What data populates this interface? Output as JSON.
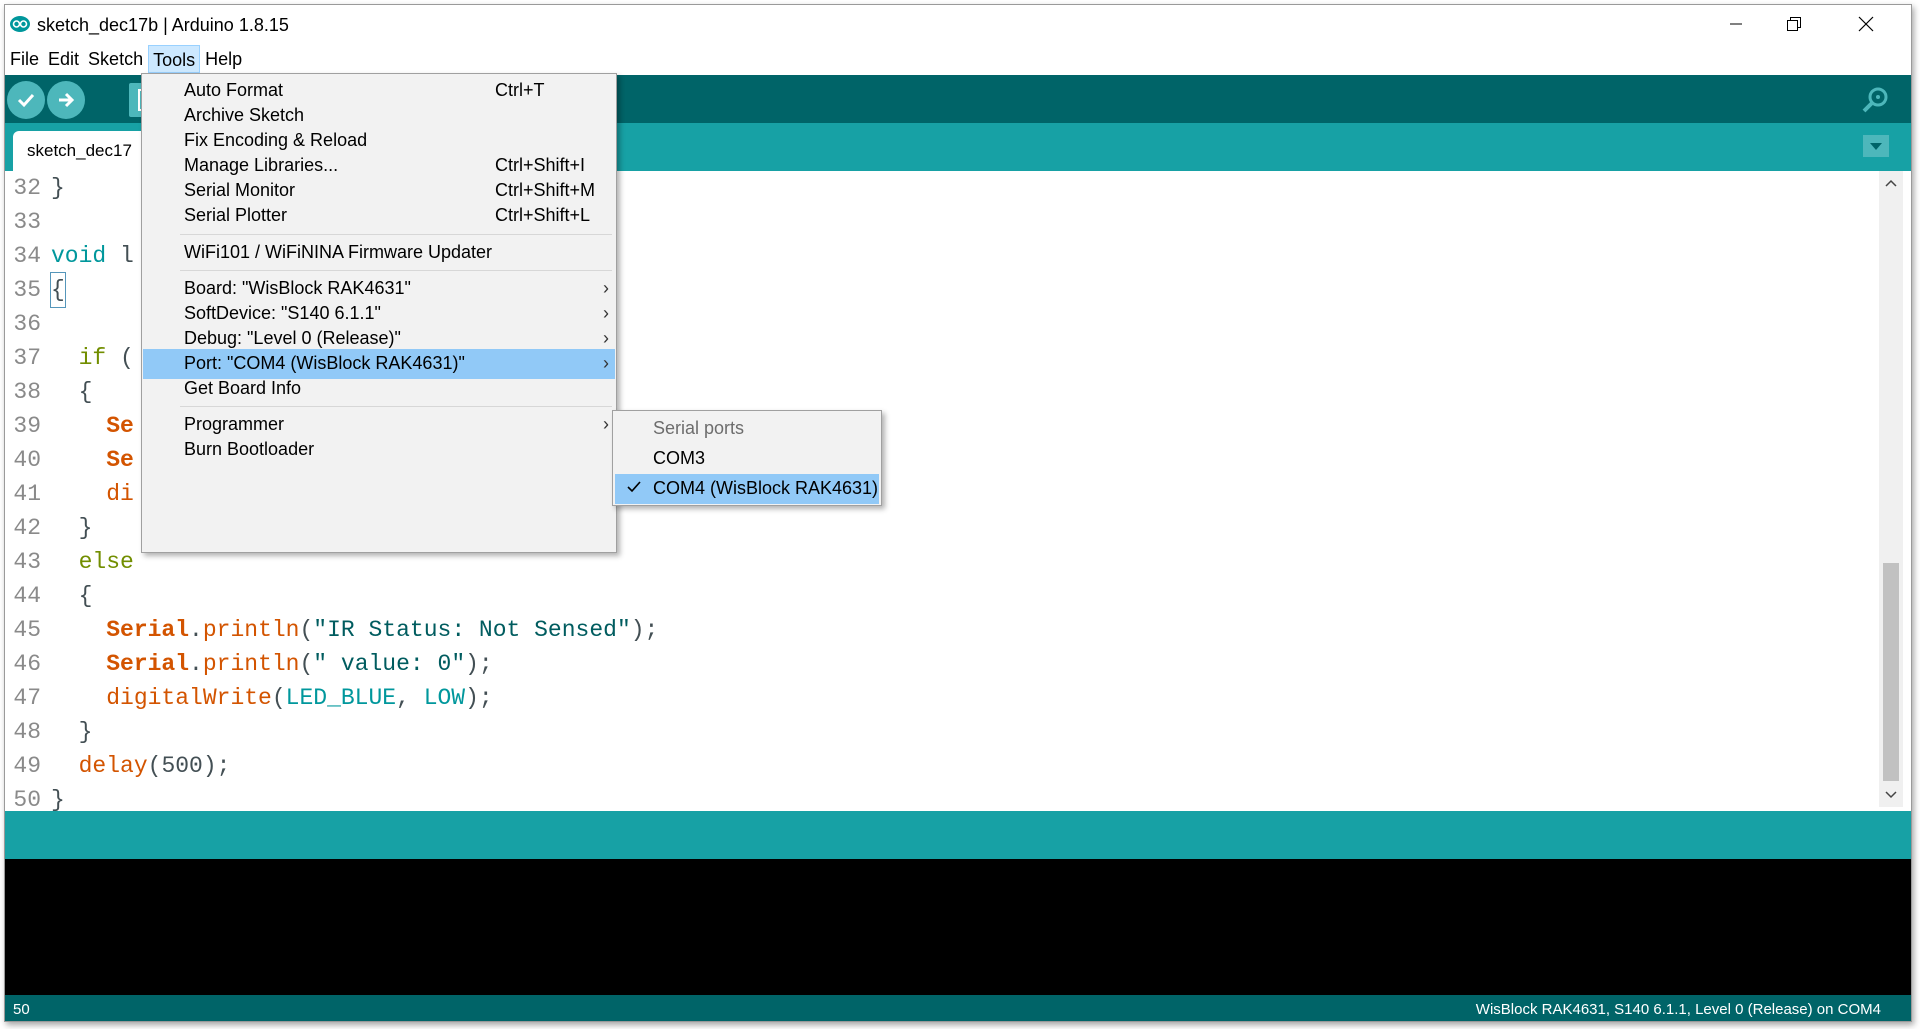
{
  "window": {
    "title": "sketch_dec17b | Arduino 1.8.15"
  },
  "menubar": {
    "items": [
      "File",
      "Edit",
      "Sketch",
      "Tools",
      "Help"
    ]
  },
  "toolbar": {
    "verify_icon": "checkmark-icon",
    "upload_icon": "arrow-right-icon",
    "new_icon": "document-icon",
    "serial_monitor_icon": "magnifier-icon"
  },
  "tabs": {
    "active_label": "sketch_dec17"
  },
  "editor": {
    "lines": [
      {
        "n": "32",
        "code": "}"
      },
      {
        "n": "33",
        "code": ""
      },
      {
        "n": "34",
        "code": "void l"
      },
      {
        "n": "35",
        "code": "{"
      },
      {
        "n": "36",
        "code": ""
      },
      {
        "n": "37",
        "code": "  if ("
      },
      {
        "n": "38",
        "code": "  {"
      },
      {
        "n": "39",
        "code": "    Se"
      },
      {
        "n": "40",
        "code": "    Se"
      },
      {
        "n": "41",
        "code": "    di"
      },
      {
        "n": "42",
        "code": "  }"
      },
      {
        "n": "43",
        "code": "  else"
      },
      {
        "n": "44",
        "code": "  {"
      },
      {
        "n": "45",
        "code": "    Serial.println(\"IR Status: Not Sensed\");"
      },
      {
        "n": "46",
        "code": "    Serial.println(\" value: 0\");"
      },
      {
        "n": "47",
        "code": "    digitalWrite(LED_BLUE, LOW);"
      },
      {
        "n": "48",
        "code": "  }"
      },
      {
        "n": "49",
        "code": "  delay(500);"
      },
      {
        "n": "50",
        "code": "}"
      }
    ],
    "tokens": {
      "l34_void": "void",
      "l34_rest": " l",
      "l37_if": "if",
      "l37_rest": " (",
      "l39_se": "Se",
      "l40_se": "Se",
      "l41_di": "di",
      "l43_else": "else",
      "serial": "Serial",
      "dot": ".",
      "println": "println",
      "l45_str": "\"IR Status: Not Sensed\"",
      "l46_str": "\" value: 0\"",
      "digitalWrite": "digitalWrite",
      "led_blue": "LED_BLUE",
      "low": "LOW",
      "delay": "delay",
      "delay_arg": "500"
    }
  },
  "tools_menu": {
    "items": [
      {
        "label": "Auto Format",
        "shortcut": "Ctrl+T"
      },
      {
        "label": "Archive Sketch",
        "shortcut": ""
      },
      {
        "label": "Fix Encoding & Reload",
        "shortcut": ""
      },
      {
        "label": "Manage Libraries...",
        "shortcut": "Ctrl+Shift+I"
      },
      {
        "label": "Serial Monitor",
        "shortcut": "Ctrl+Shift+M"
      },
      {
        "label": "Serial Plotter",
        "shortcut": "Ctrl+Shift+L"
      },
      {
        "label": "WiFi101 / WiFiNINA Firmware Updater",
        "shortcut": ""
      },
      {
        "label": "Board: \"WisBlock RAK4631\"",
        "shortcut": ""
      },
      {
        "label": "SoftDevice: \"S140  6.1.1\"",
        "shortcut": ""
      },
      {
        "label": "Debug: \"Level 0 (Release)\"",
        "shortcut": ""
      },
      {
        "label": "Port: \"COM4 (WisBlock RAK4631)\"",
        "shortcut": ""
      },
      {
        "label": "Get Board Info",
        "shortcut": ""
      },
      {
        "label": "Programmer",
        "shortcut": ""
      },
      {
        "label": "Burn Bootloader",
        "shortcut": ""
      }
    ],
    "submenu_arrow": "›"
  },
  "port_submenu": {
    "header": "Serial ports",
    "items": [
      "COM3",
      "COM4 (WisBlock RAK4631)"
    ],
    "selected": "COM4 (WisBlock RAK4631)"
  },
  "status": {
    "line_number": "50",
    "board_info": "WisBlock RAK4631, S140  6.1.1, Level 0 (Release) on COM4"
  },
  "colors": {
    "toolbar_bg": "#006468",
    "tab_bg": "#17a1a5",
    "menu_highlight": "#91c9f7",
    "keyword_orange": "#d35400",
    "keyword_teal": "#00979c",
    "keyword_green": "#728e00"
  }
}
